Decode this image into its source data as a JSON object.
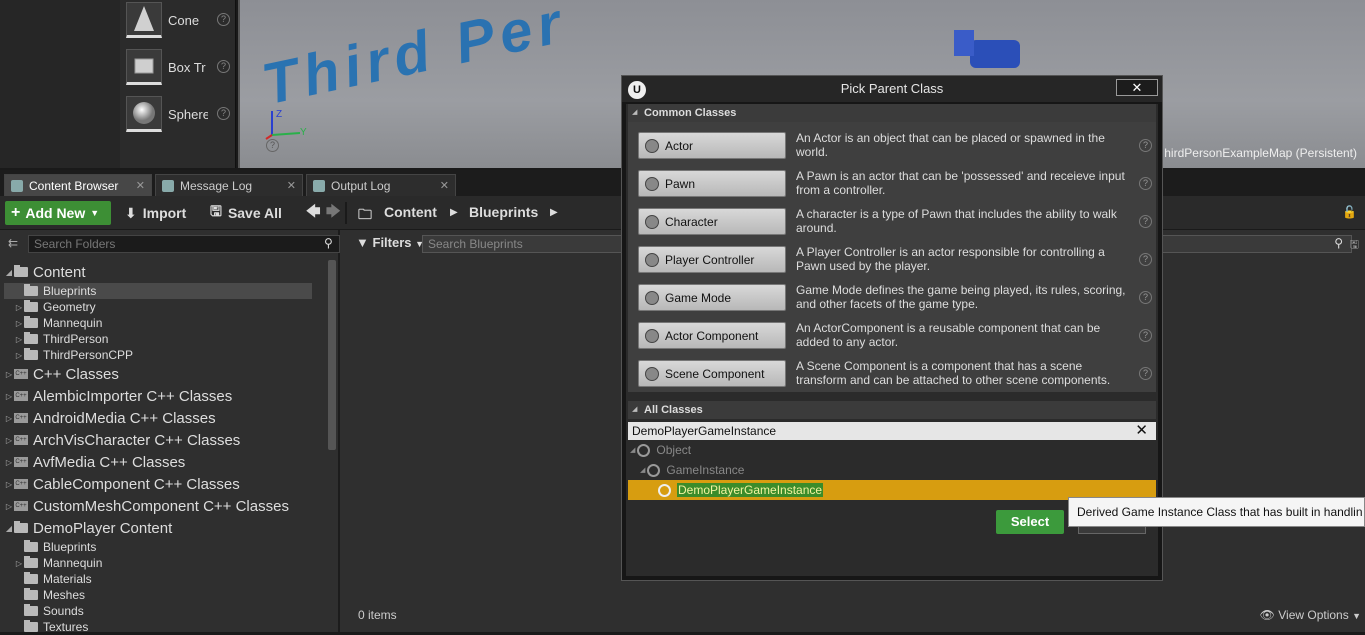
{
  "place_items": [
    {
      "label": "Cone"
    },
    {
      "label": "Box Tr"
    },
    {
      "label": "Sphere"
    }
  ],
  "viewport": {
    "overlay_text": "Third Per",
    "map_label": "hirdPersonExampleMap (Persistent)",
    "axis_z": "Z",
    "axis_y": "Y"
  },
  "tabs": [
    {
      "label": "Content Browser"
    },
    {
      "label": "Message Log"
    },
    {
      "label": "Output Log"
    }
  ],
  "toolbar": {
    "add_new": "Add New",
    "import": "Import",
    "save_all": "Save All"
  },
  "breadcrumb": [
    "Content",
    "Blueprints"
  ],
  "folders": {
    "search_placeholder": "Search Folders",
    "tree": [
      {
        "label": "Content",
        "level": 0,
        "expanded": true
      },
      {
        "label": "Blueprints",
        "level": 1
      },
      {
        "label": "Geometry",
        "level": 1
      },
      {
        "label": "Mannequin",
        "level": 1
      },
      {
        "label": "ThirdPerson",
        "level": 1
      },
      {
        "label": "ThirdPersonCPP",
        "level": 1
      },
      {
        "label": "C++ Classes",
        "level": 0
      },
      {
        "label": "AlembicImporter C++ Classes",
        "level": 0
      },
      {
        "label": "AndroidMedia C++ Classes",
        "level": 0
      },
      {
        "label": "ArchVisCharacter C++ Classes",
        "level": 0
      },
      {
        "label": "AvfMedia C++ Classes",
        "level": 0
      },
      {
        "label": "CableComponent C++ Classes",
        "level": 0
      },
      {
        "label": "CustomMeshComponent C++ Classes",
        "level": 0
      },
      {
        "label": "DemoPlayer Content",
        "level": 0,
        "expanded": true
      },
      {
        "label": "Blueprints",
        "level": 1
      },
      {
        "label": "Mannequin",
        "level": 1
      },
      {
        "label": "Materials",
        "level": 1
      },
      {
        "label": "Meshes",
        "level": 1
      },
      {
        "label": "Sounds",
        "level": 1
      },
      {
        "label": "Textures",
        "level": 1
      }
    ]
  },
  "assets": {
    "filters": "Filters",
    "search_placeholder": "Search Blueprints",
    "items_count": "0 items",
    "view_options": "View Options"
  },
  "dialog": {
    "title": "Pick Parent Class",
    "close": "✕",
    "common_header": "Common Classes",
    "all_header": "All Classes",
    "common_classes": [
      {
        "label": "Actor",
        "desc": "An Actor is an object that can be placed or spawned in the world."
      },
      {
        "label": "Pawn",
        "desc": "A Pawn is an actor that can be 'possessed' and receieve input from a controller."
      },
      {
        "label": "Character",
        "desc": "A character is a type of Pawn that includes the ability to walk around."
      },
      {
        "label": "Player Controller",
        "desc": "A Player Controller is an actor responsible for controlling a Pawn used by the player."
      },
      {
        "label": "Game Mode",
        "desc": "Game Mode defines the game being played, its rules, scoring, and other facets of the game type."
      },
      {
        "label": "Actor Component",
        "desc": "An ActorComponent is a reusable component that can be added to any actor."
      },
      {
        "label": "Scene Component",
        "desc": "A Scene Component is a component that has a scene transform and can be attached to other scene components."
      }
    ],
    "class_search_value": "DemoPlayerGameInstance",
    "class_tree": [
      {
        "label": "Object"
      },
      {
        "label": "GameInstance"
      },
      {
        "label": "DemoPlayerGameInstance"
      }
    ],
    "select": "Select"
  },
  "tooltip": "Derived Game Instance Class that has built in handlin",
  "colors": {
    "accent_green": "#3d8f35",
    "selection_orange": "#d79d10",
    "ue_blue": "#1f6fb4"
  }
}
